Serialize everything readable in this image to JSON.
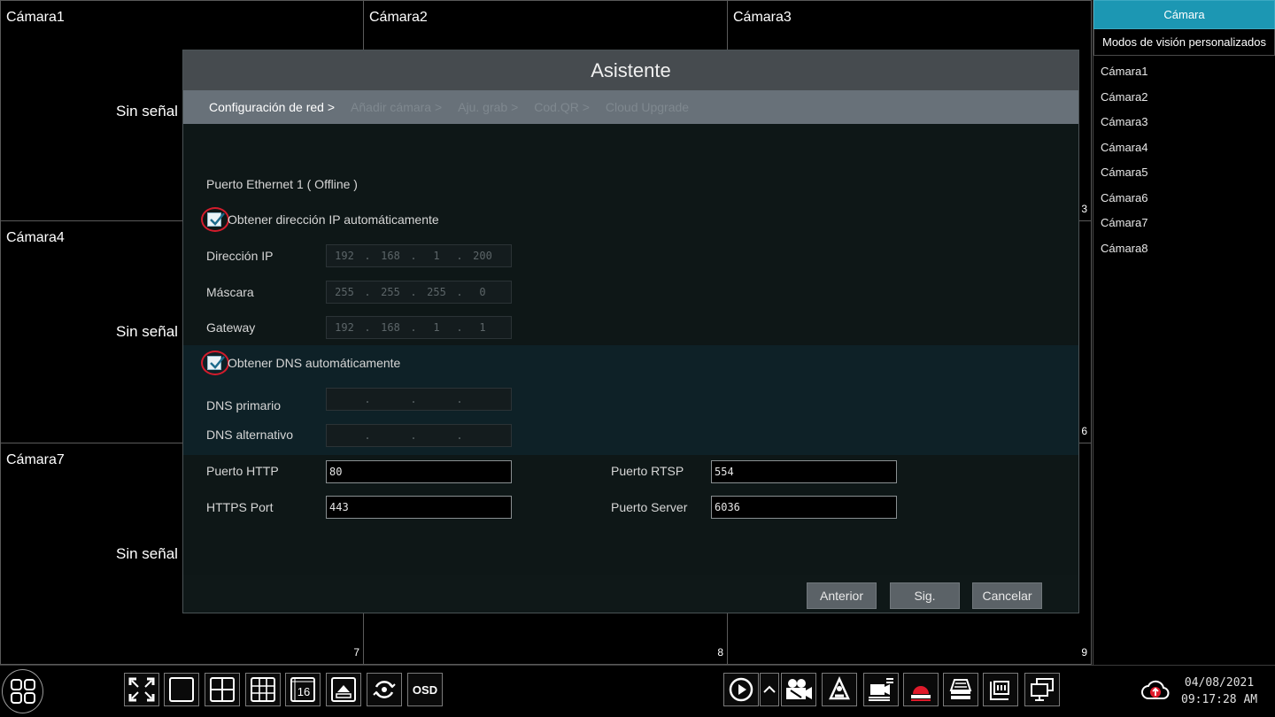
{
  "cameras": [
    {
      "title": "Cámara1",
      "nosignal": "Sin señal",
      "num": ""
    },
    {
      "title": "Cámara2",
      "nosignal": "",
      "num": ""
    },
    {
      "title": "Cámara3",
      "nosignal": "",
      "num": "3"
    },
    {
      "title": "Cámara4",
      "nosignal": "Sin señal",
      "num": ""
    },
    {
      "title": "",
      "nosignal": "",
      "num": ""
    },
    {
      "title": "",
      "nosignal": "",
      "num": "6"
    },
    {
      "title": "Cámara7",
      "nosignal": "Sin señal",
      "num": "7"
    },
    {
      "title": "",
      "nosignal": "",
      "num": "8"
    },
    {
      "title": "",
      "nosignal": "",
      "num": "9"
    }
  ],
  "sidebar": {
    "tab": "Cámara",
    "modes": "Modos de visión personalizados",
    "items": [
      "Cámara1",
      "Cámara2",
      "Cámara3",
      "Cámara4",
      "Cámara5",
      "Cámara6",
      "Cámara7",
      "Cámara8"
    ]
  },
  "dialog": {
    "title": "Asistente",
    "steps": [
      "Configuración de red >",
      "Añadir cámara >",
      "Aju. grab >",
      "Cod.QR >",
      "Cloud Upgrade"
    ],
    "port_header": "Puerto Ethernet 1 ( Offline )",
    "auto_ip_label": "Obtener dirección IP automáticamente",
    "auto_ip_checked": true,
    "ip_label": "Dirección IP",
    "ip": [
      "192",
      "168",
      "1",
      "200"
    ],
    "mask_label": "Máscara",
    "mask": [
      "255",
      "255",
      "255",
      "0"
    ],
    "gateway_label": "Gateway",
    "gateway": [
      "192",
      "168",
      "1",
      "1"
    ],
    "auto_dns_label": "Obtener DNS automáticamente",
    "auto_dns_checked": true,
    "dns1_label": "DNS primario",
    "dns1": [
      "",
      "",
      "",
      ""
    ],
    "dns2_label": "DNS alternativo",
    "dns2": [
      "",
      "",
      "",
      ""
    ],
    "http_label": "Puerto HTTP",
    "http": "80",
    "https_label": "HTTPS Port",
    "https": "443",
    "rtsp_label": "Puerto RTSP",
    "rtsp": "554",
    "server_label": "Puerto Server",
    "server": "6036",
    "buttons": {
      "prev": "Anterior",
      "next": "Sig.",
      "cancel": "Cancelar"
    }
  },
  "taskbar": {
    "osd_label": "OSD",
    "layout_16_label": "16",
    "date": "04/08/2021",
    "time": "09:17:28 AM"
  },
  "colors": {
    "accent": "#1c97b3",
    "highlight_ring": "#d41c2c"
  }
}
